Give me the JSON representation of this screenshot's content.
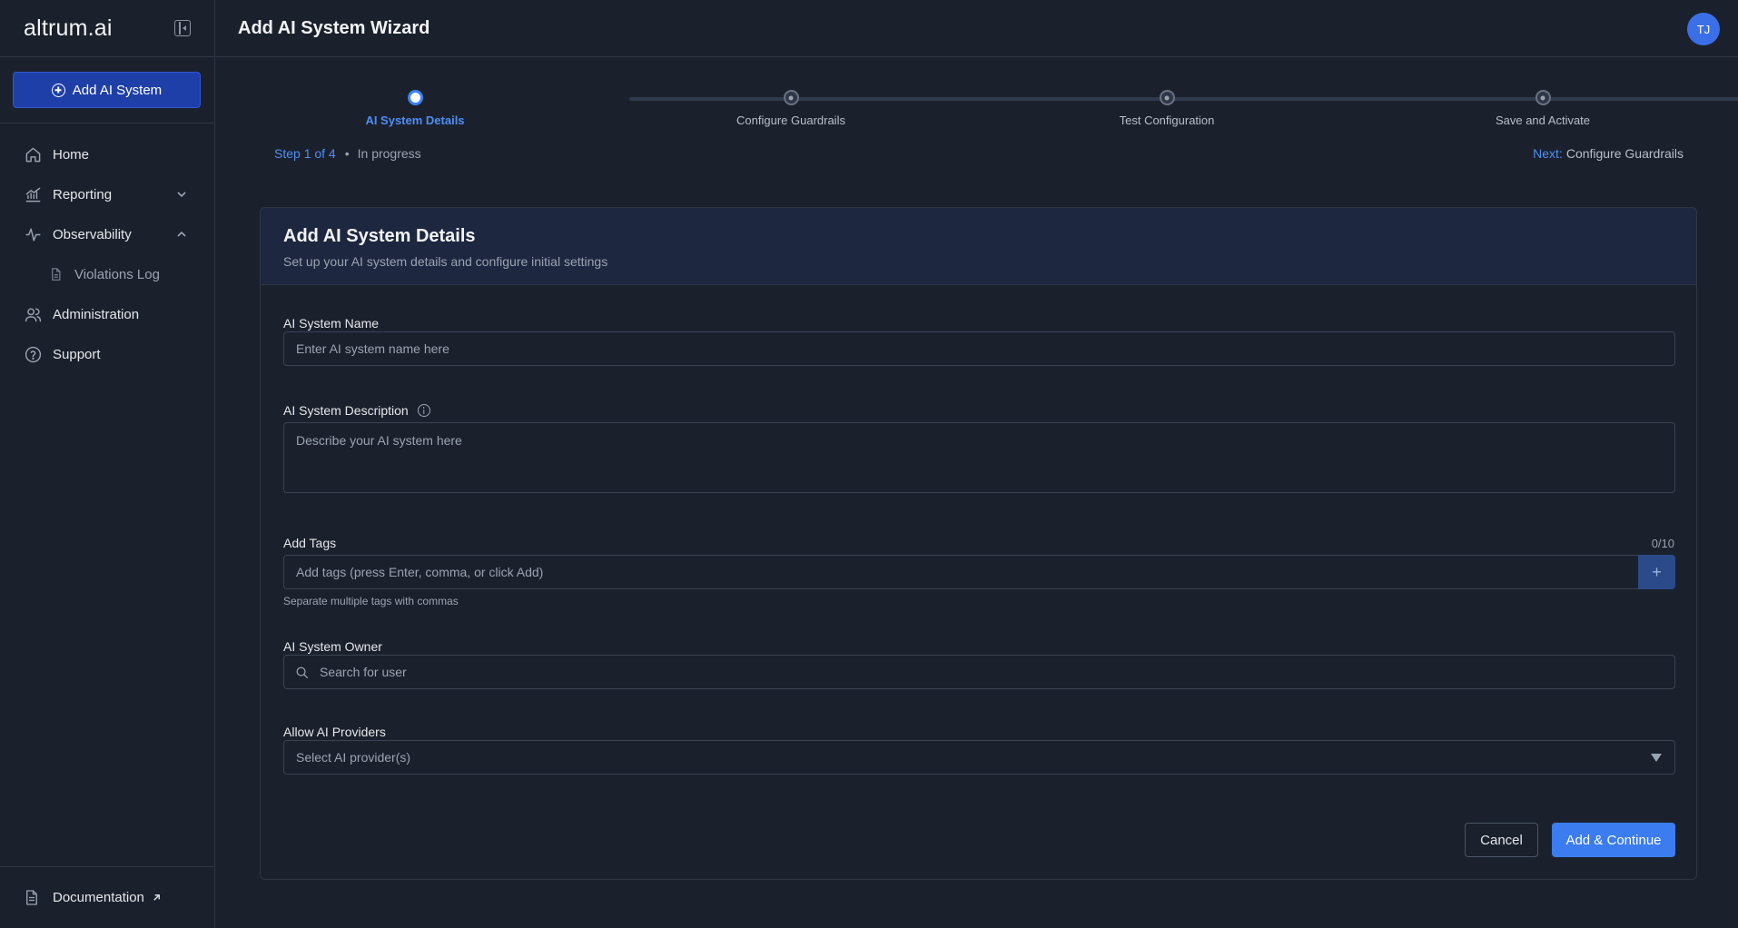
{
  "sidebar": {
    "logo": "altrum.ai",
    "add_button": "Add AI System",
    "items": [
      {
        "label": "Home",
        "icon": "home-icon"
      },
      {
        "label": "Reporting",
        "icon": "chart-icon"
      },
      {
        "label": "Observability",
        "icon": "activity-icon"
      },
      {
        "label": "Violations Log",
        "icon": "document-icon"
      },
      {
        "label": "Administration",
        "icon": "users-icon"
      },
      {
        "label": "Support",
        "icon": "help-circle-icon"
      }
    ],
    "footer": {
      "label": "Documentation",
      "icon": "external-link-icon"
    }
  },
  "header": {
    "title": "Add AI System Wizard",
    "avatar_initials": "TJ"
  },
  "stepper": {
    "steps": [
      {
        "label": "AI System Details",
        "active": true
      },
      {
        "label": "Configure Guardrails",
        "active": false
      },
      {
        "label": "Test Configuration",
        "active": false
      },
      {
        "label": "Save and Activate",
        "active": false
      }
    ],
    "step_count": "Step 1 of 4",
    "bullet": "•",
    "status": "In progress",
    "next_label": "Next:",
    "next_value": "Configure Guardrails"
  },
  "form": {
    "title": "Add AI System Details",
    "subtitle": "Set up your AI system details and configure initial settings",
    "name_label": "AI System Name",
    "name_placeholder": "Enter AI system name here",
    "description_label": "AI System Description",
    "description_placeholder": "Describe your AI system here",
    "tags_label": "Add Tags",
    "tags_count": "0/10",
    "tags_placeholder": "Add tags (press Enter, comma, or click Add)",
    "tags_add": "+",
    "tags_hint": "Separate multiple tags with commas",
    "owner_label": "AI System Owner",
    "owner_placeholder": "Search for user",
    "providers_label": "Allow AI Providers",
    "providers_placeholder": "Select AI provider(s)",
    "cancel": "Cancel",
    "submit": "Add & Continue"
  },
  "colors": {
    "background": "#1b212c",
    "accent": "#3b7cf0",
    "primary_sidebar_button": "#1f3fa8",
    "card_header": "#1e2740"
  }
}
